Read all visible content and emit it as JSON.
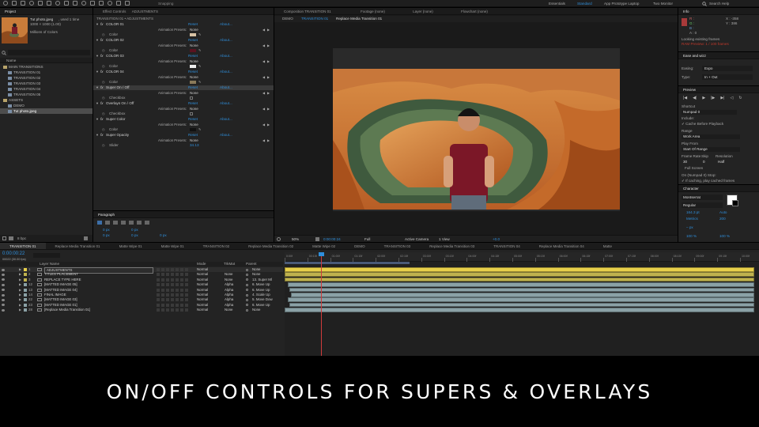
{
  "toolbar": {
    "tools": [
      "home-tool",
      "selection-tool",
      "hand-tool",
      "zoom-tool",
      "orbit-tool",
      "pan-tool",
      "dolly-tool",
      "rectangle-tool",
      "pen-tool",
      "type-tool",
      "brush-tool",
      "clone-tool",
      "eraser-tool",
      "roto-tool",
      "puppet-tool"
    ],
    "snapping": "Snapping",
    "workspaces": [
      "Essentials",
      "Standard",
      "App Prototype Laptop",
      "Two Monitor"
    ],
    "active_workspace": "Standard",
    "search": "Search Help"
  },
  "project": {
    "tab": "Project",
    "selected_name": "Tut photo.jpeg",
    "selected_used": ", used 1 time",
    "selected_size": "1000 × 1000 (1.00)",
    "selected_colors": "Millions of Colors",
    "column": "Name",
    "items": [
      "MAIN TRANSITIONS",
      "TRANSITION 01",
      "TRANSITION 02",
      "TRANSITION 03",
      "TRANSITION 04",
      "TRANSITION 05",
      "ASSETS",
      "DEMO",
      "Tut photo.jpeg"
    ],
    "bpc": "8 bpc"
  },
  "effects": {
    "tab": "Effect Controls",
    "layer": "ADJUSTMENTS",
    "header": "TRANSITION 01 • ADJUSTMENTS",
    "groups": [
      {
        "name": "COLOR 01",
        "reset": "Reset",
        "about": "About..."
      },
      {
        "name": "COLOR 02",
        "reset": "Reset",
        "about": "About..."
      },
      {
        "name": "COLOR 03",
        "reset": "Reset",
        "about": "About..."
      },
      {
        "name": "COLOR 04",
        "reset": "Reset",
        "about": "About..."
      },
      {
        "name": "Super On / Off",
        "reset": "Reset",
        "about": "About..."
      },
      {
        "name": "Overlays On / Off",
        "reset": "Reset",
        "about": "About..."
      },
      {
        "name": "Super Color",
        "reset": "Reset",
        "about": "About..."
      },
      {
        "name": "Super Opacity",
        "reset": "Reset",
        "about": "About..."
      }
    ],
    "anim_label": "Animation Presets:",
    "anim_value": "None",
    "color_label": "Color",
    "checkbox_label": "Checkbox",
    "slider_label": "Slider",
    "slider_value": "34.13",
    "swatches": [
      "#d8c3a5",
      "#5a1320",
      "#ececec",
      "#8a7a5a",
      "#cfcfcf",
      "#111111"
    ]
  },
  "paragraph": {
    "tab": "Paragraph",
    "fields": [
      "0 px",
      "0 px",
      "0 px",
      "0 px",
      "0 px"
    ]
  },
  "composition": {
    "tabs": [
      "Composition TRANSITION 01",
      "Footage (none)",
      "Layer (none)",
      "Flowchart (none)"
    ],
    "breadcrumbs": [
      "DEMO",
      "TRANSITION 01",
      "Replace Media Transition 01"
    ],
    "zoom": "50%",
    "timecode": "0:00:00:24",
    "resolution": "Full",
    "camera": "Active Camera",
    "views": "1 View",
    "exposure": "+0.0"
  },
  "info": {
    "tab": "Info",
    "r": "R :",
    "g": "G :",
    "b": "B :",
    "a": "A : 0",
    "x": "X : -358",
    "y": "Y : 386",
    "status": "Looking existing frames",
    "warning": "RAM Preview: 1 / 100 frames"
  },
  "ease": {
    "tab": "Ease and wizz",
    "easing_label": "Easing:",
    "easing": "Expo",
    "type_label": "Type:",
    "type": "In + Out"
  },
  "preview": {
    "tab": "Preview",
    "shortcut_label": "Shortcut",
    "shortcut": "Numpad 0",
    "include": "Include:",
    "cache": "Cache Before Playback",
    "range_label": "Range",
    "range": "Work Area",
    "play_from_label": "Play From",
    "play_from": "Start Of Range",
    "fr_label": "Frame Rate",
    "skip_label": "Skip",
    "res_label": "Resolution",
    "fr": "30",
    "skip": "0",
    "res": "Half",
    "fullscreen": "Full Screen",
    "numpad": "On (Numpad 0) Stop:",
    "cached": "If caching, play cached frames"
  },
  "character": {
    "tab": "Character",
    "font": "Montserrat",
    "style": "Regular",
    "size": "164.3 pt",
    "leading": "Auto",
    "kerning": "Metrics",
    "tracking": "200",
    "stroke": "– px",
    "scale_v": "100 %",
    "scale_h": "100 %"
  },
  "timeline": {
    "tabs": [
      "TRANSITION 01",
      "Replace Media Transition 01",
      "Matte Wipe 01",
      "Matte Wipe 01",
      "TRANSITION 02",
      "Replace Media Transition 02",
      "Matte Wipe 02",
      "DEMO",
      "TRANSITION 03",
      "Replace Media Transition 03",
      "TRANSITION 04",
      "Replace Media Transition 04",
      "Matte"
    ],
    "timecode": "0:00:00:22",
    "frames": "00022 (30.00 fps)",
    "headers": {
      "layer": "Layer Name",
      "mode": "Mode",
      "trkmat": "TrkMat",
      "parent": "Parent"
    },
    "layers": [
      {
        "num": "1",
        "name": "ADJUSTMENTS",
        "mode": "Normal",
        "trk": "",
        "parent": "None",
        "color": "#e7cf4a"
      },
      {
        "num": "2",
        "name": "TITLES PLACEMENT",
        "mode": "Normal",
        "trk": "None",
        "parent": "None",
        "color": "#bfb24e"
      },
      {
        "num": "3",
        "name": "REPLACE TYPE HERE",
        "mode": "Normal",
        "trk": "None",
        "parent": "13. Super Ml",
        "color": "#bfb24e"
      },
      {
        "num": "12",
        "name": "[MATTED IMAGE 05]",
        "mode": "Normal",
        "trk": "Alpha",
        "parent": "6. Move Up",
        "color": "#8aa1a6"
      },
      {
        "num": "13",
        "name": "[MATTED IMAGE 04]",
        "mode": "Normal",
        "trk": "Alpha",
        "parent": "6. Move Up",
        "color": "#8aa1a6"
      },
      {
        "num": "14",
        "name": "FINAL IMAGE",
        "mode": "Normal",
        "trk": "Alpha",
        "parent": "4. Scale Up",
        "color": "#8aa1a6"
      },
      {
        "num": "22",
        "name": "[MATTED IMAGE 03]",
        "mode": "Normal",
        "trk": "Alpha",
        "parent": "5. Move Dow",
        "color": "#8aa1a6"
      },
      {
        "num": "23",
        "name": "[MATTED IMAGE 01]",
        "mode": "Normal",
        "trk": "Alpha",
        "parent": "6. Move Up",
        "color": "#8aa1a6"
      },
      {
        "num": "28",
        "name": "[Replace Media Transition 01]",
        "mode": "Normal",
        "trk": "None",
        "parent": "None",
        "color": "#8aa1a6"
      }
    ],
    "ruler": [
      "0:00f",
      "00:15f",
      "01:00f",
      "01:15f",
      "02:00f",
      "02:15f",
      "03:00f",
      "03:15f",
      "04:00f",
      "04:15f",
      "05:00f",
      "05:15f",
      "06:00f",
      "06:15f",
      "07:00f",
      "07:15f",
      "08:00f",
      "08:15f",
      "09:00f",
      "09:15f",
      "10:00f"
    ]
  },
  "caption": "ON/OFF CONTROLS FOR SUPERS & OVERLAYS"
}
